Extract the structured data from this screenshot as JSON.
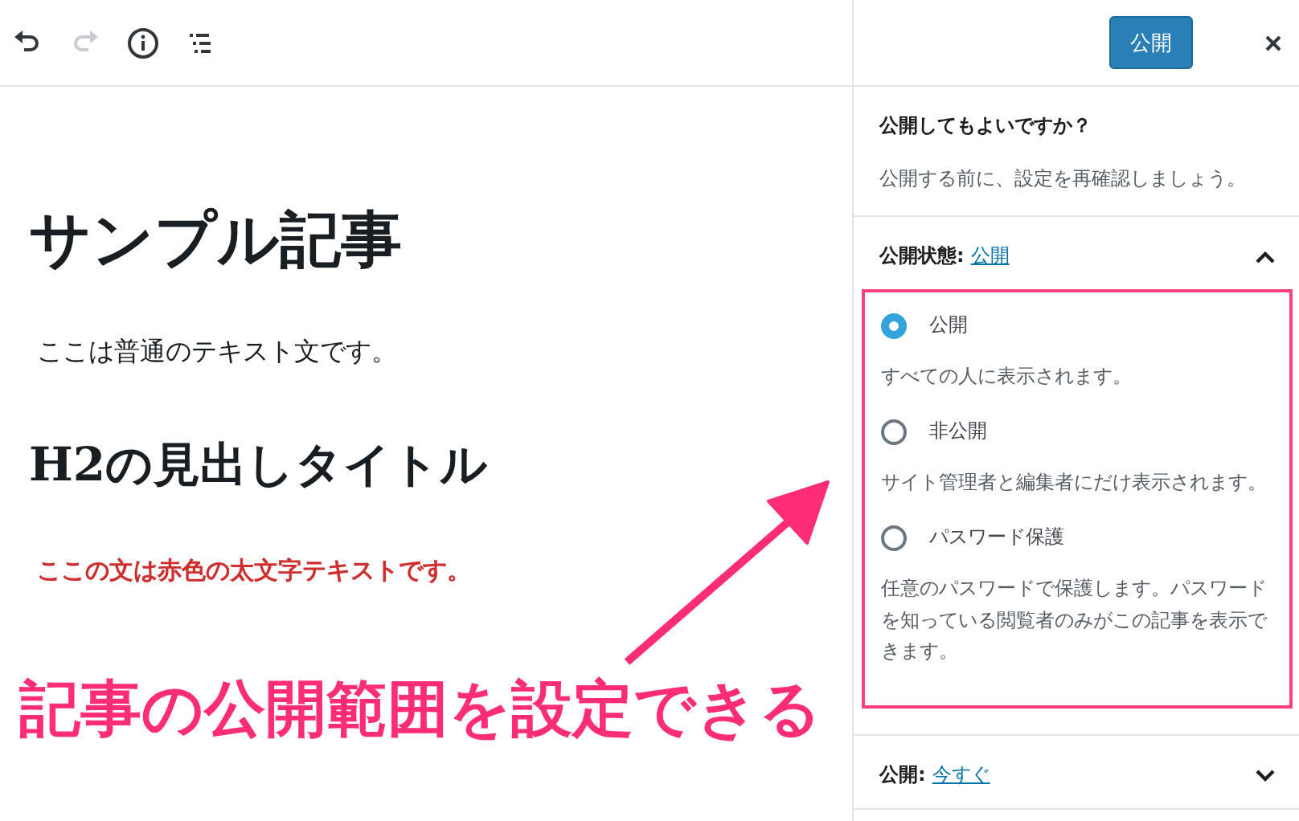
{
  "editor": {
    "blocks": [
      {
        "kind": "h1",
        "text": "サンプル記事"
      },
      {
        "kind": "p",
        "text": "ここは普通のテキスト文です。"
      },
      {
        "kind": "h2",
        "text": "H2の見出しタイトル"
      },
      {
        "kind": "p-red",
        "text": "ここの文は赤色の太文字テキストです。"
      }
    ]
  },
  "sidebar": {
    "publish_button": "公開",
    "check": {
      "title": "公開してもよいですか？",
      "description": "公開する前に、設定を再確認しましょう。"
    },
    "visibility": {
      "label": "公開状態:",
      "value": "公開",
      "expanded": true,
      "options": [
        {
          "label": "公開",
          "description": "すべての人に表示されます。",
          "selected": true
        },
        {
          "label": "非公開",
          "description": "サイト管理者と編集者にだけ表示されます。",
          "selected": false
        },
        {
          "label": "パスワード保護",
          "description": "任意のパスワードで保護します。パスワードを知っている閲覧者のみがこの記事を表示できます。",
          "selected": false
        }
      ]
    },
    "schedule": {
      "label": "公開:",
      "value": "今すぐ",
      "expanded": false
    }
  },
  "annotation": {
    "caption": "記事の公開範囲を設定できる"
  }
}
